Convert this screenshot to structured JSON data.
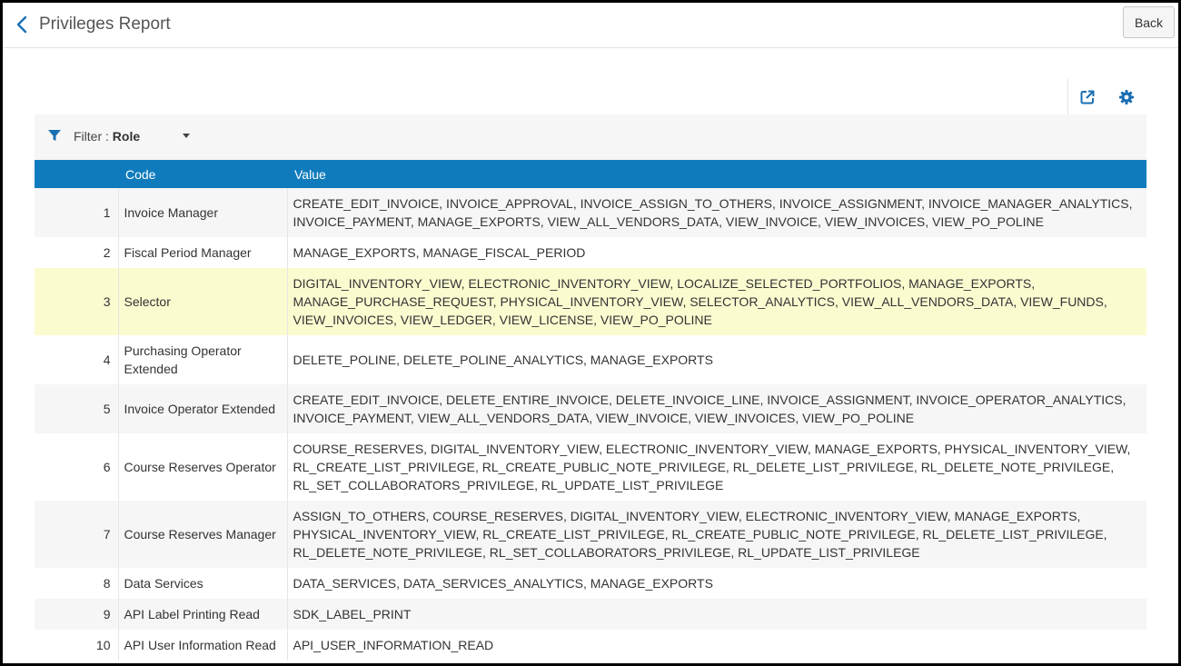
{
  "header": {
    "title": "Privileges Report",
    "back_label": "Back",
    "back_icon": "chevron-left-icon"
  },
  "toolbar": {
    "export_icon": "external-link-icon",
    "settings_icon": "gear-icon"
  },
  "filter": {
    "prefix": "Filter :",
    "value": "Role",
    "icon": "funnel-icon"
  },
  "colors": {
    "accent": "#0f7bbd",
    "highlight_row": "#fbfbd0"
  },
  "table": {
    "columns": [
      "",
      "Code",
      "Value"
    ],
    "rows": [
      {
        "index": "1",
        "code": "Invoice Manager",
        "value": "CREATE_EDIT_INVOICE, INVOICE_APPROVAL, INVOICE_ASSIGN_TO_OTHERS, INVOICE_ASSIGNMENT, INVOICE_MANAGER_ANALYTICS, INVOICE_PAYMENT, MANAGE_EXPORTS, VIEW_ALL_VENDORS_DATA, VIEW_INVOICE, VIEW_INVOICES, VIEW_PO_POLINE"
      },
      {
        "index": "2",
        "code": "Fiscal Period Manager",
        "value": "MANAGE_EXPORTS, MANAGE_FISCAL_PERIOD"
      },
      {
        "index": "3",
        "code": "Selector",
        "value": "DIGITAL_INVENTORY_VIEW, ELECTRONIC_INVENTORY_VIEW, LOCALIZE_SELECTED_PORTFOLIOS, MANAGE_EXPORTS, MANAGE_PURCHASE_REQUEST, PHYSICAL_INVENTORY_VIEW, SELECTOR_ANALYTICS, VIEW_ALL_VENDORS_DATA, VIEW_FUNDS, VIEW_INVOICES, VIEW_LEDGER, VIEW_LICENSE, VIEW_PO_POLINE",
        "highlight": true
      },
      {
        "index": "4",
        "code": "Purchasing Operator Extended",
        "value": "DELETE_POLINE, DELETE_POLINE_ANALYTICS, MANAGE_EXPORTS"
      },
      {
        "index": "5",
        "code": "Invoice Operator Extended",
        "value": "CREATE_EDIT_INVOICE, DELETE_ENTIRE_INVOICE, DELETE_INVOICE_LINE, INVOICE_ASSIGNMENT, INVOICE_OPERATOR_ANALYTICS, INVOICE_PAYMENT, VIEW_ALL_VENDORS_DATA, VIEW_INVOICE, VIEW_INVOICES, VIEW_PO_POLINE"
      },
      {
        "index": "6",
        "code": "Course Reserves Operator",
        "value": "COURSE_RESERVES, DIGITAL_INVENTORY_VIEW, ELECTRONIC_INVENTORY_VIEW, MANAGE_EXPORTS, PHYSICAL_INVENTORY_VIEW, RL_CREATE_LIST_PRIVILEGE, RL_CREATE_PUBLIC_NOTE_PRIVILEGE, RL_DELETE_LIST_PRIVILEGE, RL_DELETE_NOTE_PRIVILEGE, RL_SET_COLLABORATORS_PRIVILEGE, RL_UPDATE_LIST_PRIVILEGE"
      },
      {
        "index": "7",
        "code": "Course Reserves Manager",
        "value": "ASSIGN_TO_OTHERS, COURSE_RESERVES, DIGITAL_INVENTORY_VIEW, ELECTRONIC_INVENTORY_VIEW, MANAGE_EXPORTS, PHYSICAL_INVENTORY_VIEW, RL_CREATE_LIST_PRIVILEGE, RL_CREATE_PUBLIC_NOTE_PRIVILEGE, RL_DELETE_LIST_PRIVILEGE, RL_DELETE_NOTE_PRIVILEGE, RL_SET_COLLABORATORS_PRIVILEGE, RL_UPDATE_LIST_PRIVILEGE"
      },
      {
        "index": "8",
        "code": "Data Services",
        "value": "DATA_SERVICES, DATA_SERVICES_ANALYTICS, MANAGE_EXPORTS"
      },
      {
        "index": "9",
        "code": "API Label Printing Read",
        "value": "SDK_LABEL_PRINT"
      },
      {
        "index": "10",
        "code": "API User Information Read",
        "value": "API_USER_INFORMATION_READ"
      }
    ]
  }
}
